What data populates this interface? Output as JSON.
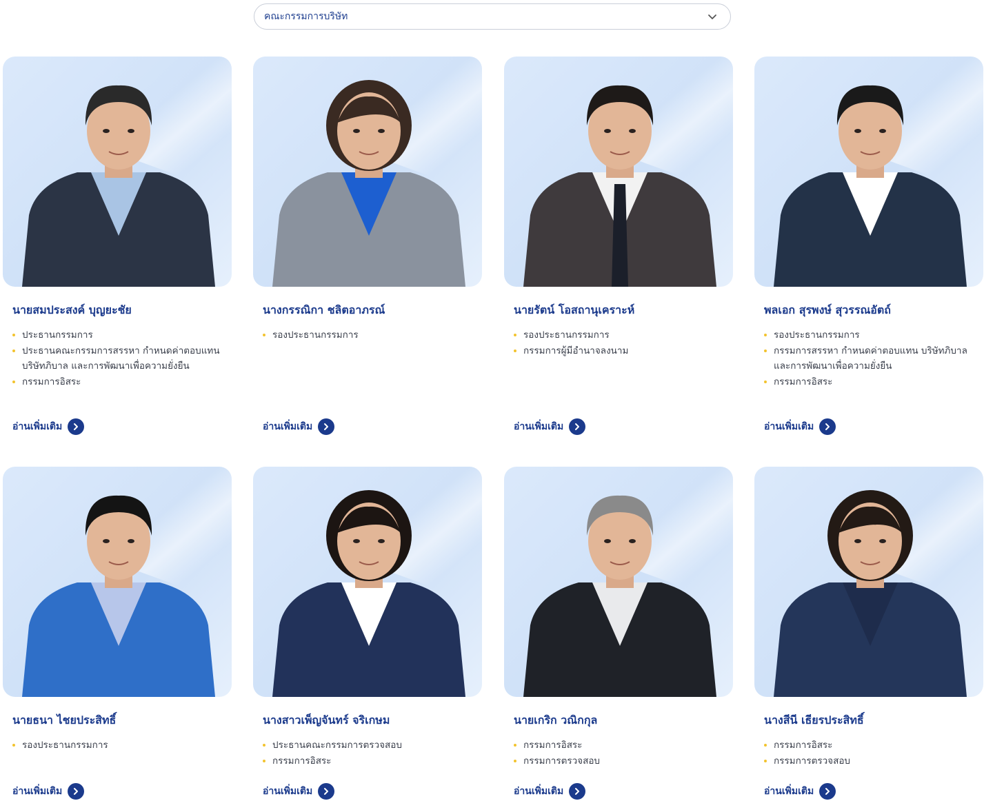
{
  "filter": {
    "selected": "คณะกรรมการบริษัท"
  },
  "read_more_label": "อ่านเพิ่มเติม",
  "colors": {
    "accent": "#1b3a8c",
    "bullet": "#f2c32e",
    "photo_bg": "#d6e6fa"
  },
  "members": [
    {
      "name": "นายสมประสงค์ บุญยะชัย",
      "roles": [
        "ประธานกรรมการ",
        "ประธานคณะกรรมการสรรหา กำหนดค่าตอบแทน บริษัทภิบาล และการพัฒนาเพื่อความยั่งยืน",
        "กรรมการอิสระ"
      ],
      "suit": "#2b3445",
      "shirt": "#a9c4e4",
      "hair": "#2a2a2a",
      "tie": ""
    },
    {
      "name": "นางกรรณิกา ชลิตอาภรณ์",
      "roles": [
        "รองประธานกรรมการ"
      ],
      "suit": "#8a929e",
      "shirt": "#1d5fd0",
      "hair": "#3a2a22",
      "tie": ""
    },
    {
      "name": "นายรัตน์ โอสถานุเคราะห์",
      "roles": [
        "รองประธานกรรมการ",
        "กรรมการผู้มีอำนาจลงนาม"
      ],
      "suit": "#3f3a3d",
      "shirt": "#f2f2f2",
      "hair": "#1e1a18",
      "tie": "#1b1f2a"
    },
    {
      "name": "พลเอก สุรพงษ์ สุวรรณอัตถ์",
      "roles": [
        "รองประธานกรรมการ",
        "กรรมการสรรหา กำหนดค่าตอบแทน บริษัทภิบาล และการพัฒนาเพื่อความยั่งยืน",
        "กรรมการอิสระ"
      ],
      "suit": "#233248",
      "shirt": "#ffffff",
      "hair": "#1a1a1a",
      "tie": ""
    },
    {
      "name": "นายธนา ไชยประสิทธิ์",
      "roles": [
        "รองประธานกรรมการ"
      ],
      "suit": "#2f6fc8",
      "shirt": "#b7c6ea",
      "hair": "#141414",
      "tie": ""
    },
    {
      "name": "นางสาวเพ็ญจันทร์ จริเกษม",
      "roles": [
        "ประธานคณะกรรมการตรวจสอบ",
        "กรรมการอิสระ"
      ],
      "suit": "#22325a",
      "shirt": "#ffffff",
      "hair": "#1c1512",
      "tie": ""
    },
    {
      "name": "นายเกริก วณิกกุล",
      "roles": [
        "กรรมการอิสระ",
        "กรรมการตรวจสอบ"
      ],
      "suit": "#1f2228",
      "shirt": "#e9eaec",
      "hair": "#8a8a8a",
      "tie": ""
    },
    {
      "name": "นางสีนี เธียรประสิทธิ์",
      "roles": [
        "กรรมการอิสระ",
        "กรรมการตรวจสอบ"
      ],
      "suit": "#24365a",
      "shirt": "#1e2c4c",
      "hair": "#231a15",
      "tie": ""
    }
  ]
}
